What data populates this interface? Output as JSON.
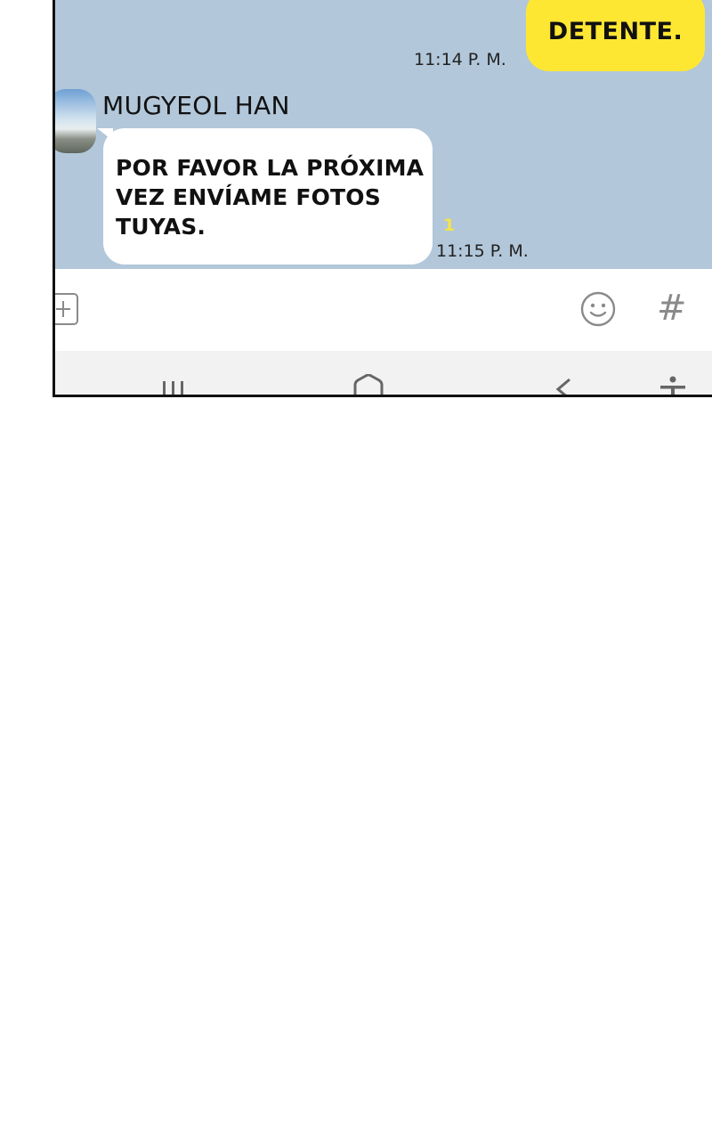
{
  "messages": {
    "sent": {
      "text": "DETENTE.",
      "time": "11:14 P. M."
    },
    "received": {
      "sender": "MUGYEOL HAN",
      "lines": [
        "POR FAVOR LA PRÓXIMA",
        "VEZ ENVÍAME FOTOS",
        "TUYAS."
      ],
      "unread": "1",
      "time": "11:15 P. M."
    }
  },
  "input_bar": {
    "icons": [
      "plus-icon",
      "emoji-icon",
      "hash-icon"
    ],
    "hash_glyph": "#"
  },
  "nav_bar": {
    "icons": [
      "recents-icon",
      "home-icon",
      "back-icon",
      "accessibility-icon"
    ]
  },
  "colors": {
    "chat_background": "#b2c7da",
    "sent_bubble": "#fee733",
    "received_bubble": "#ffffff",
    "unread_count": "#f4e34a"
  }
}
